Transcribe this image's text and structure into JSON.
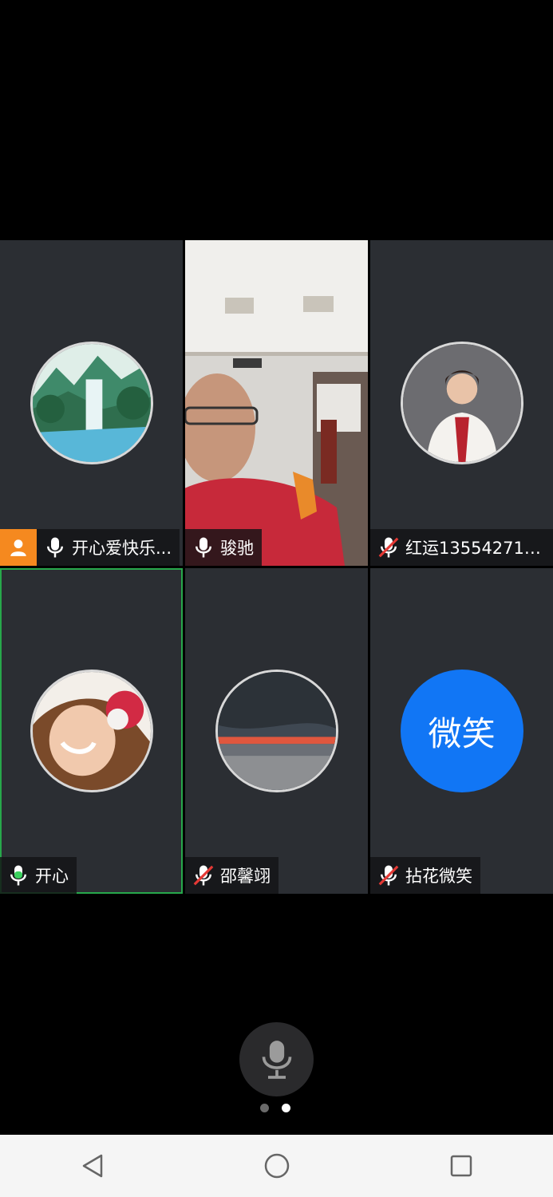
{
  "participants": [
    {
      "name": "开心爱快乐...",
      "mic": "on",
      "host": true,
      "avatar": "landscape-waterfall"
    },
    {
      "name": "骏驰",
      "mic": "on",
      "host": false,
      "avatar": "video-feed"
    },
    {
      "name": "红运135542714...",
      "mic": "muted",
      "host": false,
      "avatar": "woman-portrait"
    },
    {
      "name": "开心",
      "mic": "speaking",
      "host": false,
      "avatar": "child-flower",
      "active": true
    },
    {
      "name": "邵馨翊",
      "mic": "muted",
      "host": false,
      "avatar": "sunset-sea"
    },
    {
      "name": "拈花微笑",
      "mic": "muted",
      "host": false,
      "avatar_text": "微笑",
      "avatar_color": "#1176f5"
    }
  ],
  "controls": {
    "mute_icon": "microphone-icon"
  },
  "pager": {
    "total": 2,
    "current": 2
  },
  "colors": {
    "tile_bg": "#2b2e33",
    "active_border": "#27a84b",
    "host_badge": "#f5891f",
    "muted": "#e53935",
    "speaking": "#3ad15e"
  }
}
